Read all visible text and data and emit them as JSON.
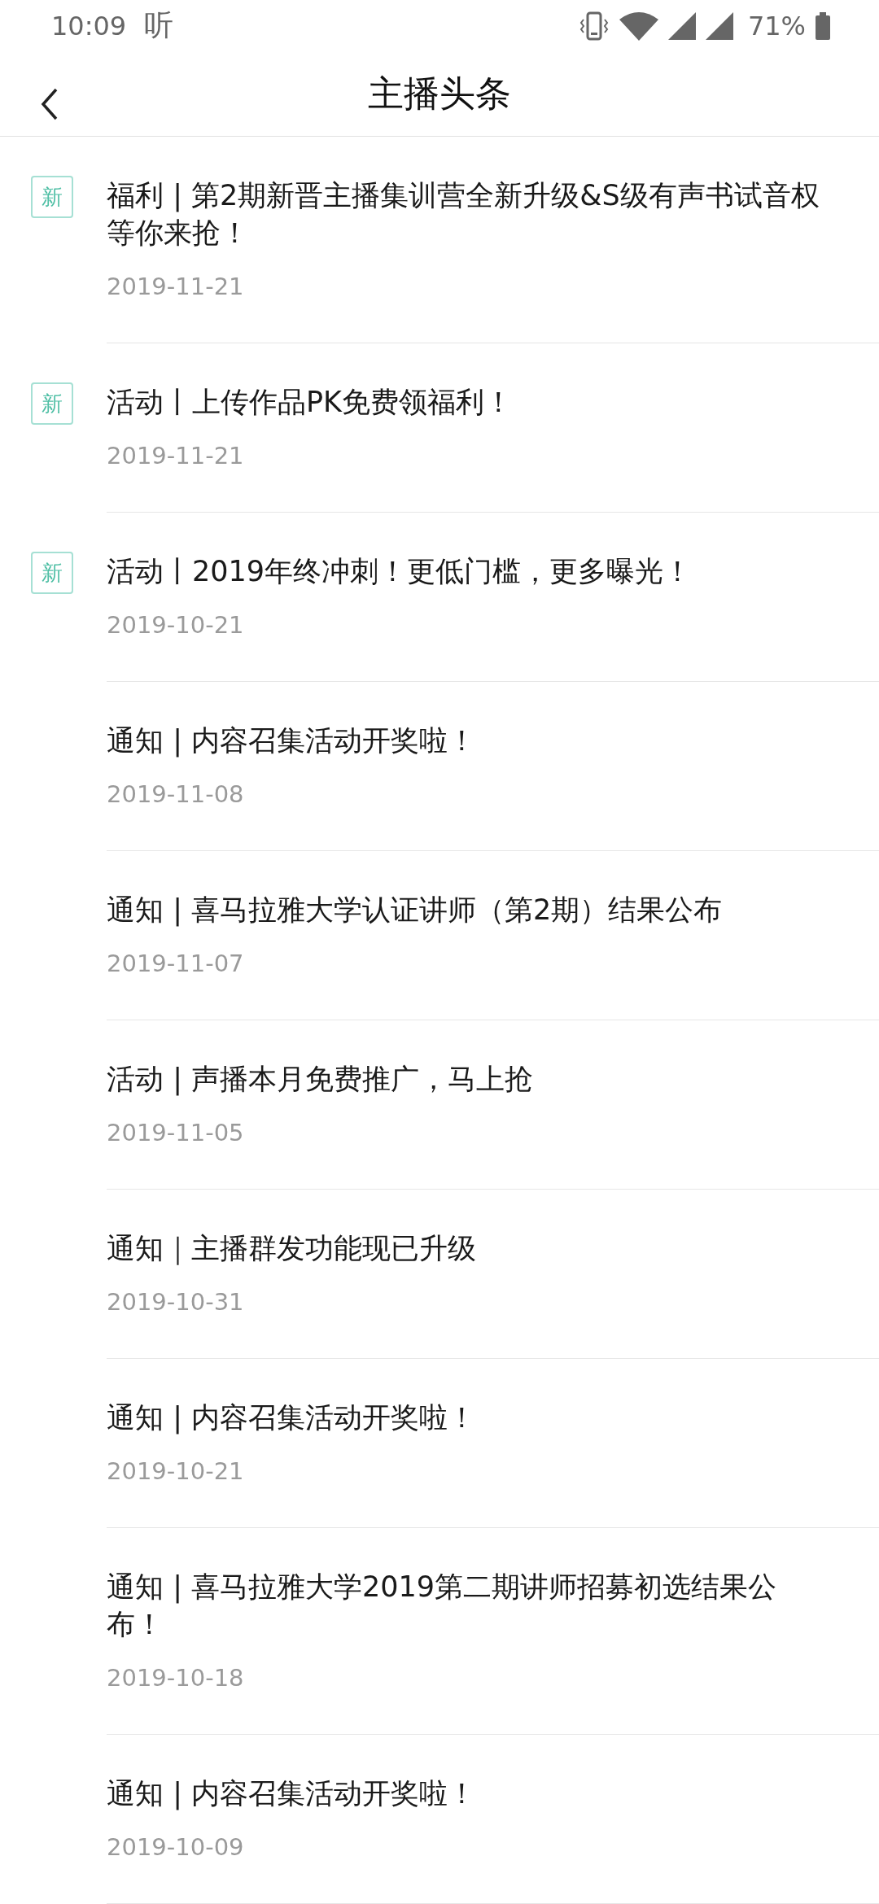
{
  "status_bar": {
    "time": "10:09",
    "app_glyph": "听",
    "battery_text": "71%"
  },
  "header": {
    "title": "主播头条"
  },
  "items": [
    {
      "badge": "新",
      "title": "福利 | 第2期新晋主播集训营全新升级&S级有声书试音权等你来抢！",
      "date": "2019-11-21"
    },
    {
      "badge": "新",
      "title": "活动丨上传作品PK免费领福利！",
      "date": "2019-11-21"
    },
    {
      "badge": "新",
      "title": "活动丨2019年终冲刺！更低门槛，更多曝光！",
      "date": "2019-10-21"
    },
    {
      "title": "通知 | 内容召集活动开奖啦！",
      "date": "2019-11-08"
    },
    {
      "title": "通知 | 喜马拉雅大学认证讲师（第2期）结果公布",
      "date": "2019-11-07"
    },
    {
      "title": "活动 | 声播本月免费推广，马上抢",
      "date": "2019-11-05"
    },
    {
      "title": "通知｜主播群发功能现已升级",
      "date": "2019-10-31"
    },
    {
      "title": "通知 | 内容召集活动开奖啦！",
      "date": "2019-10-21"
    },
    {
      "title": "通知 | 喜马拉雅大学2019第二期讲师招募初选结果公布！",
      "date": "2019-10-18"
    },
    {
      "title": "通知 | 内容召集活动开奖啦！",
      "date": "2019-10-09"
    }
  ]
}
